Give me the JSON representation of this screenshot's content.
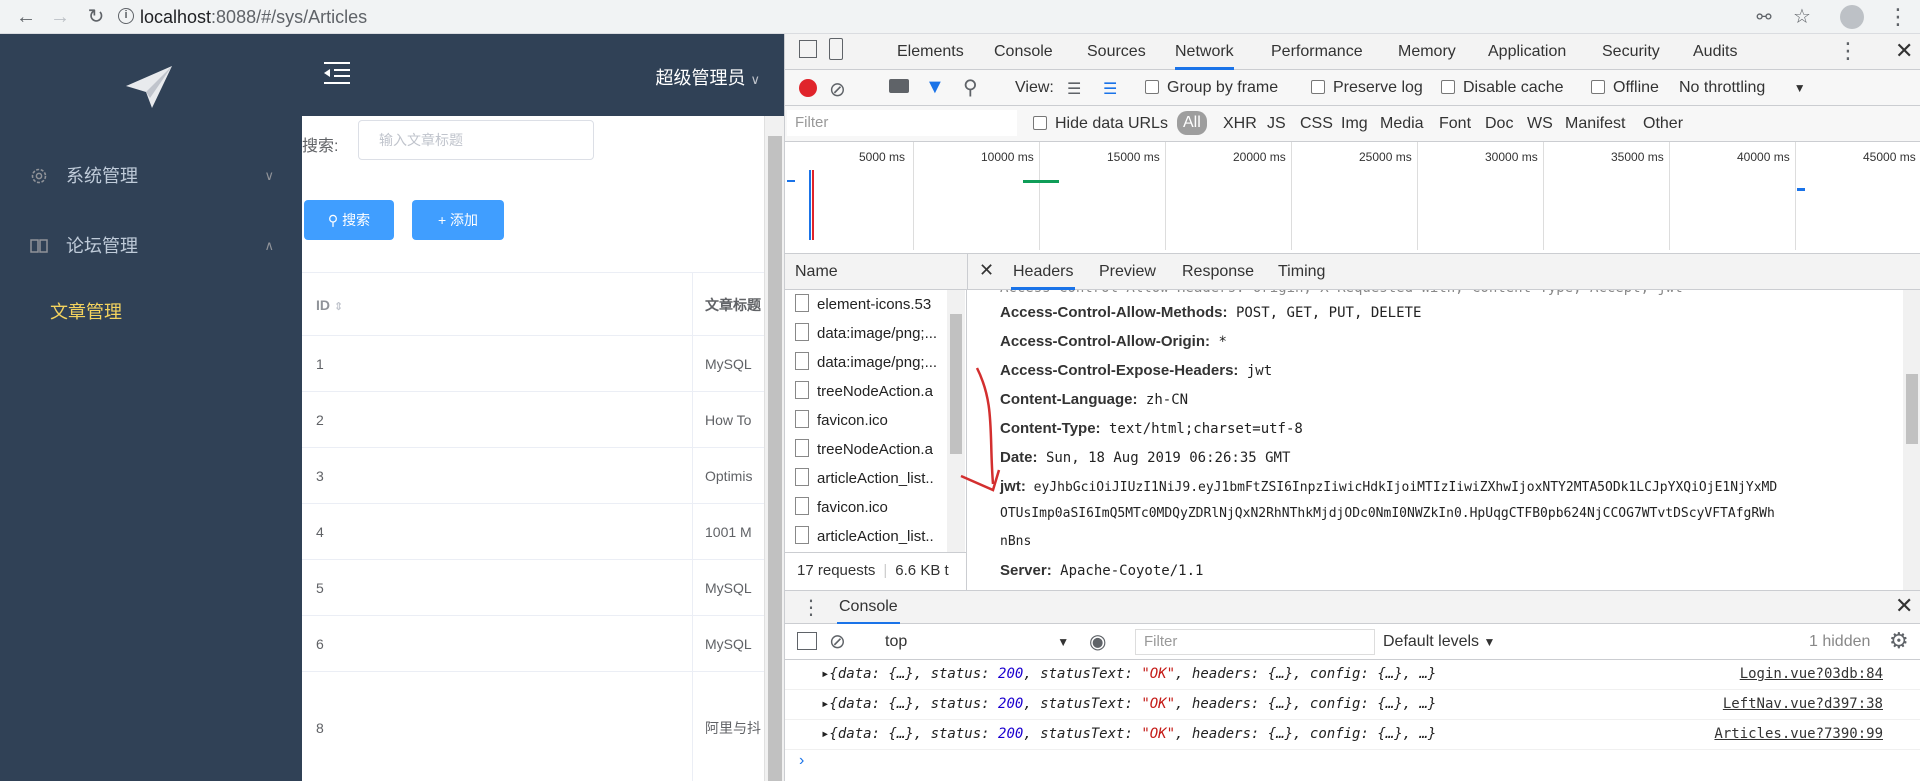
{
  "browser": {
    "url_host": "localhost",
    "url_rest": ":8088/#/sys/Articles"
  },
  "sidebar": {
    "items": [
      {
        "label": "系统管理",
        "icon": "gear-icon"
      },
      {
        "label": "论坛管理",
        "icon": "book-icon"
      }
    ],
    "sub_item": "文章管理"
  },
  "header": {
    "user": "超级管理员"
  },
  "search": {
    "label": "搜索:",
    "placeholder": "输入文章标题",
    "search_btn": "搜索",
    "add_btn": "添加"
  },
  "table": {
    "col_id": "ID",
    "col_title": "文章标题",
    "rows": [
      {
        "id": "1",
        "title": "MySQL"
      },
      {
        "id": "2",
        "title": "How To"
      },
      {
        "id": "3",
        "title": "Optimis"
      },
      {
        "id": "4",
        "title": "1001 M"
      },
      {
        "id": "5",
        "title": "MySQL"
      },
      {
        "id": "6",
        "title": "MySQL"
      },
      {
        "id": "8",
        "title": "阿里与抖"
      }
    ]
  },
  "devtools": {
    "tabs": [
      "Elements",
      "Console",
      "Sources",
      "Network",
      "Performance",
      "Memory",
      "Application",
      "Security",
      "Audits"
    ],
    "toolbar": {
      "view": "View:",
      "group_by_frame": "Group by frame",
      "preserve_log": "Preserve log",
      "disable_cache": "Disable cache",
      "offline": "Offline",
      "throttling": "No throttling"
    },
    "filter": {
      "placeholder": "Filter",
      "hide_data_urls": "Hide data URLs",
      "types": [
        "All",
        "XHR",
        "JS",
        "CSS",
        "Img",
        "Media",
        "Font",
        "Doc",
        "WS",
        "Manifest",
        "Other"
      ]
    },
    "timeline_ticks": [
      "5000 ms",
      "10000 ms",
      "15000 ms",
      "20000 ms",
      "25000 ms",
      "30000 ms",
      "35000 ms",
      "40000 ms",
      "45000 ms"
    ],
    "name_col": "Name",
    "detail_tabs": [
      "Headers",
      "Preview",
      "Response",
      "Timing"
    ],
    "requests": [
      "element-icons.53",
      "data:image/png;...",
      "data:image/png;...",
      "treeNodeAction.a",
      "favicon.ico",
      "treeNodeAction.a",
      "articleAction_list..",
      "favicon.ico",
      "articleAction_list.."
    ],
    "summary": {
      "count": "17 requests",
      "size": "6.6 KB t"
    },
    "headers": [
      {
        "key": "Access-Control-Allow-Methods:",
        "val": "POST, GET, PUT, DELETE"
      },
      {
        "key": "Access-Control-Allow-Origin:",
        "val": "*"
      },
      {
        "key": "Access-Control-Expose-Headers:",
        "val": "jwt"
      },
      {
        "key": "Content-Language:",
        "val": "zh-CN"
      },
      {
        "key": "Content-Type:",
        "val": "text/html;charset=utf-8"
      },
      {
        "key": "Date:",
        "val": "Sun, 18 Aug 2019 06:26:35 GMT"
      },
      {
        "key": "jwt:",
        "val": "eyJhbGciOiJIUzI1NiJ9.eyJ1bmFtZSI6InpzIiwicHdkIjoiMTIzIiwiZXhwIjoxNTY2MTA5ODk1LCJpYXQiOjE1NjYxMD"
      },
      {
        "key": "",
        "val": "OTUsImp0aSI6ImQ5MTc0MDQyZDRlNjQxN2RhNThkMjdjODc0NmI0NWZkIn0.HpUqgCTFB0pb624NjCCOG7WTvtDScyVFTAfgRWh"
      },
      {
        "key": "",
        "val": "nBns"
      },
      {
        "key": "Server:",
        "val": "Apache-Coyote/1.1"
      }
    ],
    "console": {
      "tab": "Console",
      "context": "top",
      "filter": "Filter",
      "levels": "Default levels",
      "hidden": "1 hidden",
      "status": "200",
      "status_text": "\"OK\"",
      "logs": [
        {
          "src": "Login.vue?03db:84"
        },
        {
          "src": "LeftNav.vue?d397:38"
        },
        {
          "src": "Articles.vue?7390:99"
        }
      ]
    }
  }
}
